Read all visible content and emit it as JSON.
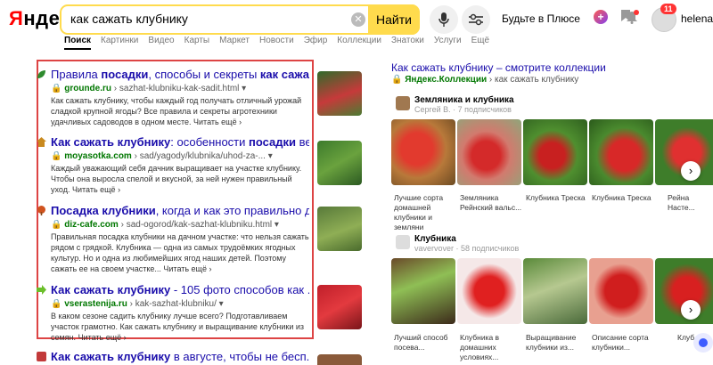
{
  "header": {
    "logo_first": "Я",
    "logo_rest": "ндекс",
    "query": "как сажать клубнику",
    "search_button": "Найти",
    "plus_text": "Будьте в Плюсе",
    "plus_badge": "+",
    "mail_count": "11",
    "username": "helenaev"
  },
  "tabs": [
    "Поиск",
    "Картинки",
    "Видео",
    "Карты",
    "Маркет",
    "Новости",
    "Эфир",
    "Коллекции",
    "Знатоки",
    "Услуги",
    "Ещё"
  ],
  "results": [
    {
      "title_parts": [
        "Правила ",
        "посадки",
        ", способы и секреты ",
        "как сажа..."
      ],
      "domain": "grounde.ru",
      "path": "› sazhat-klubniku-kak-sadit.html ▾",
      "snippet": "Как сажать клубнику, чтобы каждый год получать отличный урожай сладкой крупной ягоды? Все правила и секреты агротехники удачливых садоводов в одном месте.",
      "more": "Читать ещё ›"
    },
    {
      "title_parts": [
        "Как сажать клубнику",
        ": особенности ",
        "посадки",
        " ве..."
      ],
      "domain": "moyasotka.com",
      "path": "› sad/yagody/klubnika/uhod-za-... ▾",
      "snippet": "Каждый уважающий себя дачник выращивает на участке клубнику. Чтобы она выросла спелой и вкусной, за ней нужен правильный уход.",
      "more": "Читать ещё ›"
    },
    {
      "title_parts": [
        "Посадка клубники",
        ", когда и как это правильно д..."
      ],
      "domain": "diz-cafe.com",
      "path": "› sad-ogorod/kak-sazhat-klubniku.html ▾",
      "snippet": "Правильная посадка клубники на дачном участке: что нельзя сажать рядом с грядкой. Клубника — одна из самых трудоёмких ягодных культур. Но и одна из любимейших ягод наших детей. Поэтому сажать ее на своем участке...",
      "more": "Читать ещё ›"
    },
    {
      "title_parts": [
        "Как сажать клубнику",
        " - 105 фото способов как ..."
      ],
      "domain": "vserastenija.ru",
      "path": "› kak-sazhat-klubniku/ ▾",
      "snippet": "В каком сезоне садить клубнику лучше всего? Подготавливаем участок грамотно. Как сажать клубнику и выращивание клубники из семян.",
      "more": "Читать ещё ›"
    },
    {
      "title_parts": [
        "Как сажать клубнику",
        " в августе, чтобы не бесп..."
      ]
    }
  ],
  "collections": {
    "heading": "Как сажать клубнику – смотрите коллекции",
    "source": "Яндекс.Коллекции",
    "source_suffix": "› как сажать клубнику",
    "groups": [
      {
        "title": "Земляника и клубника",
        "owner": "Сергей В.",
        "subs": "7 подписчиков",
        "cards": [
          {
            "caption": "Лучшие сорта домашней клубники и земляни"
          },
          {
            "caption": "Земляника Рейнский вальс..."
          },
          {
            "caption": "Клубника Треска"
          },
          {
            "caption": "Рейна Насте..."
          }
        ]
      },
      {
        "title": "Клубника",
        "owner": "vavervover",
        "subs": "58 подписчиков",
        "cards": [
          {
            "caption": "Лучший способ посева..."
          },
          {
            "caption": "Клубника в домашних условиях..."
          },
          {
            "caption": "Выращивание клубники из..."
          },
          {
            "caption": "Описание сорта клубники..."
          },
          {
            "caption": "Клуб..."
          }
        ]
      }
    ]
  },
  "colors": {
    "accent": "#ffdb4d",
    "link": "#1a0dab",
    "url": "#007700",
    "highlight": "#dd4444"
  }
}
